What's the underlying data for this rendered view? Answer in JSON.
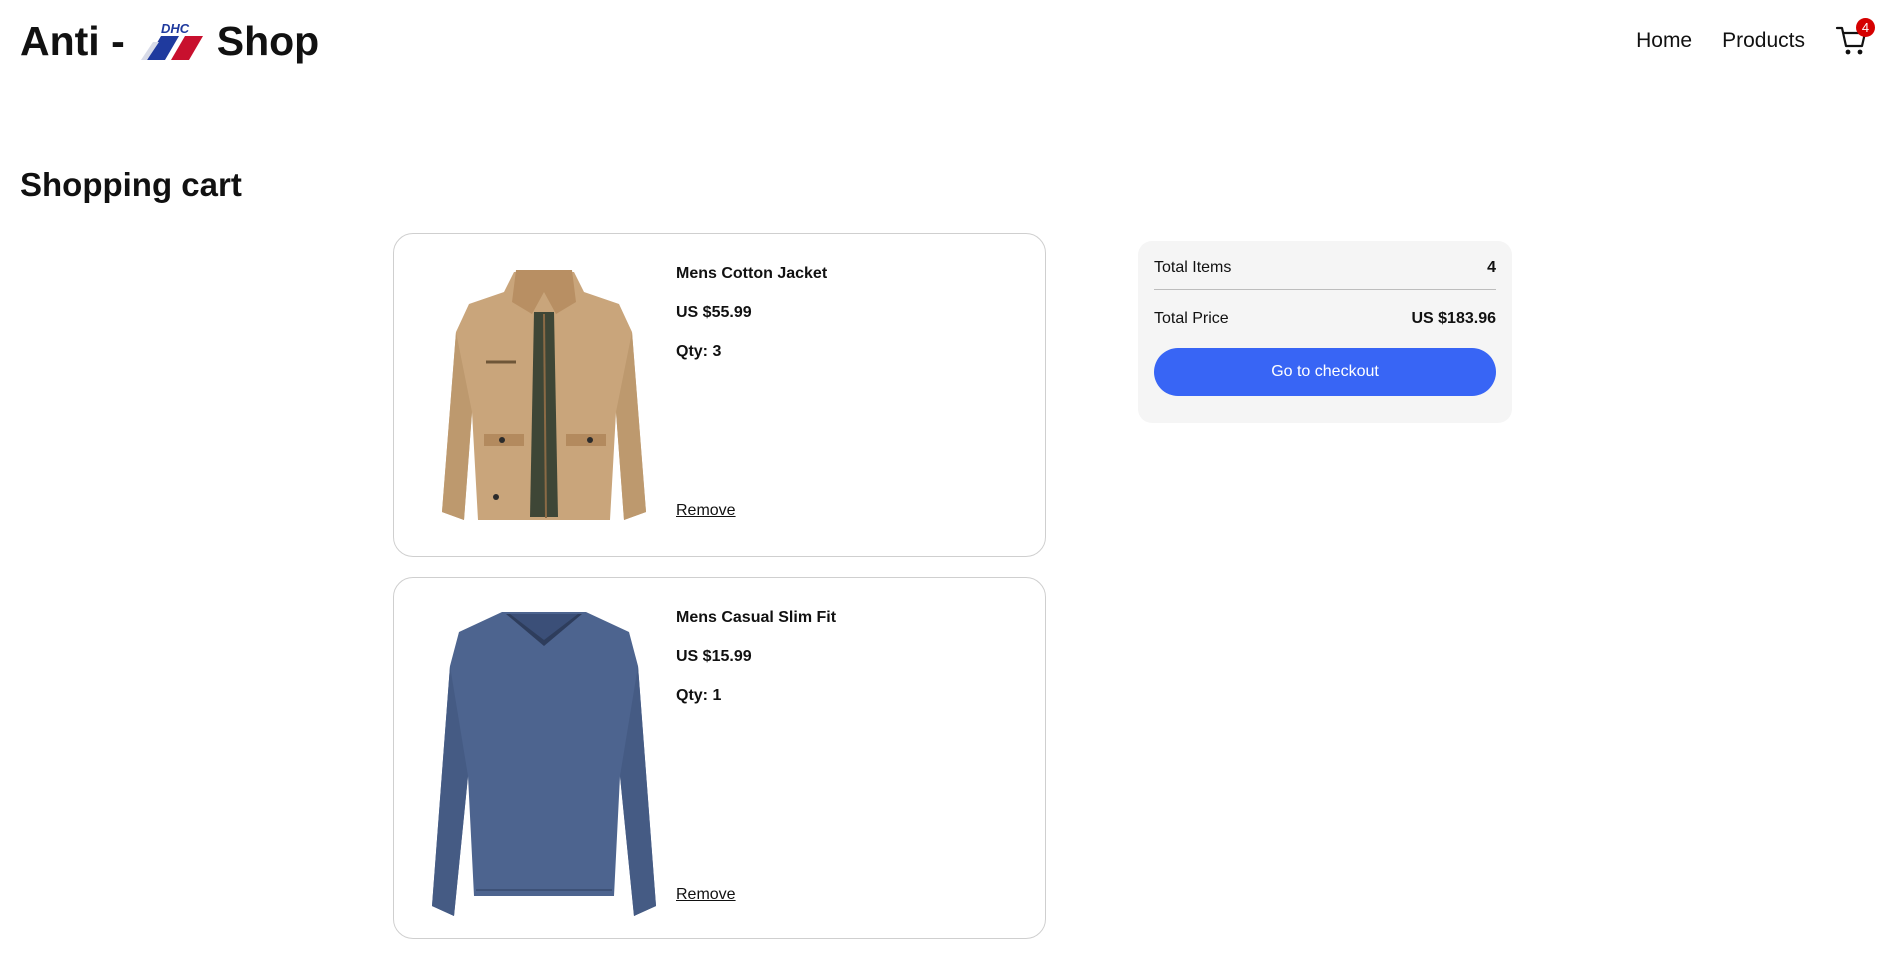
{
  "header": {
    "brand_prefix": "Anti -",
    "brand_suffix": "Shop",
    "logo_text": "DHC",
    "nav": {
      "home": "Home",
      "products": "Products"
    },
    "cart_count": "4",
    "cart_icon": "shopping-cart-icon"
  },
  "page": {
    "title": "Shopping cart"
  },
  "cart": {
    "items": [
      {
        "name": "Mens Cotton Jacket",
        "price": "US $55.99",
        "qty": "Qty: 3",
        "remove": "Remove",
        "image": "jacket-image"
      },
      {
        "name": "Mens Casual Slim Fit",
        "price": "US $15.99",
        "qty": "Qty: 1",
        "remove": "Remove",
        "image": "longsleeve-shirt-image"
      }
    ]
  },
  "summary": {
    "total_items_label": "Total Items",
    "total_items_value": "4",
    "total_price_label": "Total Price",
    "total_price_value": "US $183.96",
    "checkout_label": "Go to checkout"
  },
  "colors": {
    "accent": "#3865f5",
    "badge": "#d50000",
    "summary_bg": "#f5f5f5",
    "logo_blue": "#1f3a9e",
    "logo_red": "#c8102e"
  }
}
